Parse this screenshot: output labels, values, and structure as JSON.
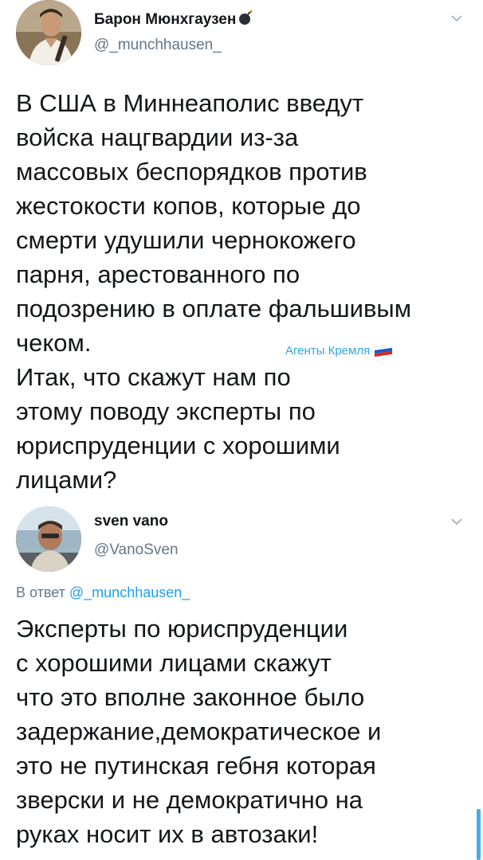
{
  "tweet1": {
    "display_name": "Барон Мюнхгаузен",
    "handle": "@_munchhausen_",
    "text_lines": [
      "В США в Миннеаполис введут",
      "войска нацгвардии из-за",
      "массовых беспорядков против",
      "жестокости копов, которые до",
      "смерти удушили чернокожего",
      "парня, арестованного по",
      "подозрению в оплате фальшивым",
      "чеком.",
      "Итак, что скажут нам по",
      "этому поводу эксперты по",
      "юриспруденции с хорошими",
      "лицами?"
    ],
    "watermark": "Агенты Кремля"
  },
  "tweet2": {
    "display_name": "sven vano",
    "handle": "@VanoSven",
    "reply_prefix": "В ответ ",
    "reply_to": "@_munchhausen_",
    "text_lines": [
      "Эксперты по юриспруденции",
      "с хорошими лицами скажут",
      "что это вполне законное было",
      "задержание,демократическое и",
      "это не путинская гебня которая",
      "зверски и не демократично на",
      "руках носит их в автозаки!"
    ]
  },
  "icons": {
    "menu": "chevron-down-icon",
    "name_emoji": "bomb-icon",
    "watermark_flag": "russia-flag-icon"
  },
  "colors": {
    "text": "#14171a",
    "secondary": "#657786",
    "link": "#1da1f2"
  }
}
